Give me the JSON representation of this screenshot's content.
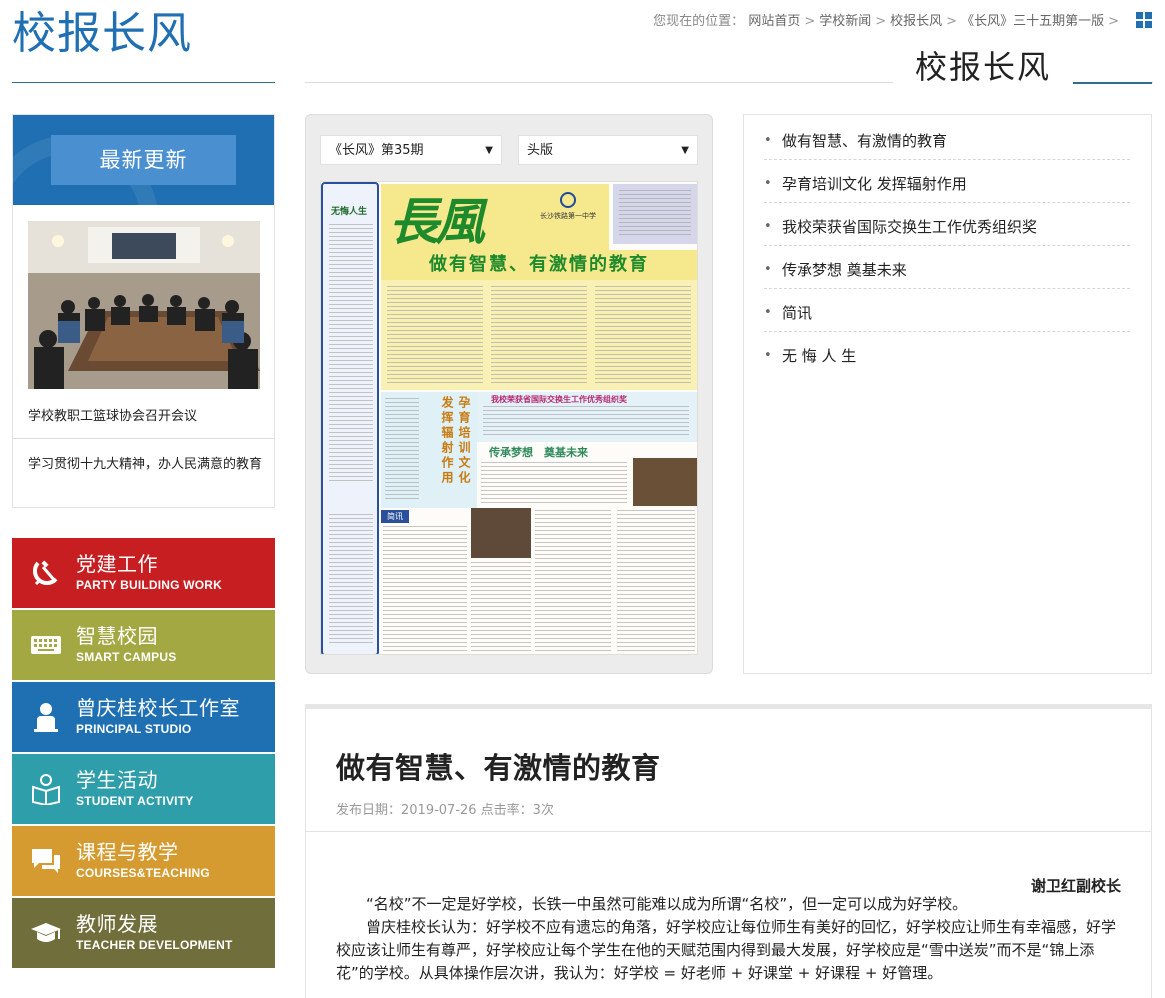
{
  "site": {
    "title": "校报长风",
    "section_title": "校报长风"
  },
  "breadcrumb": {
    "prefix": "您现在的位置：",
    "items": [
      "网站首页",
      "学校新闻",
      "校报长风",
      "《长风》三十五期第一版"
    ],
    "separator": ">"
  },
  "latest": {
    "heading": "最新更新",
    "items": [
      {
        "caption": "学校教职工篮球协会召开会议"
      },
      {
        "caption": "学习贯彻十九大精神，办人民满意的教育"
      }
    ]
  },
  "nav": [
    {
      "cn": "党建工作",
      "en": "PARTY BUILDING WORK",
      "color": "#c71e22",
      "icon": "hammer-sickle-icon"
    },
    {
      "cn": "智慧校园",
      "en": "SMART CAMPUS",
      "color": "#a3a843",
      "icon": "keyboard-icon"
    },
    {
      "cn": "曾庆桂校长工作室",
      "en": "PRINCIPAL STUDIO",
      "color": "#1e70b3",
      "icon": "person-icon"
    },
    {
      "cn": "学生活动",
      "en": "STUDENT ACTIVITY",
      "color": "#2f9eab",
      "icon": "reading-student-icon"
    },
    {
      "cn": "课程与教学",
      "en": "COURSES&TEACHING",
      "color": "#d59b30",
      "icon": "chat-bubbles-icon"
    },
    {
      "cn": "教师发展",
      "en": "TEACHER DEVELOPMENT",
      "color": "#706e3a",
      "icon": "graduation-cap-icon"
    }
  ],
  "viewer": {
    "issue_select": "《长风》第35期",
    "page_select": "头版",
    "paper": {
      "left_col_title": "无悔人生",
      "logo": "長風",
      "school": "长沙铁路第一中学",
      "headline": "做有智慧、有激情的教育",
      "vertical_title": "孕育培训文化 发挥辐射作用",
      "blue_title": "我校荣获省国际交换生工作优秀组织奖",
      "subtitle": "传承梦想　奠基未来",
      "brief": "简讯"
    }
  },
  "headlines": [
    "做有智慧、有激情的教育",
    "孕育培训文化 发挥辐射作用",
    "我校荣获省国际交换生工作优秀组织奖",
    "传承梦想 奠基未来",
    "简讯",
    "无 悔 人 生"
  ],
  "article": {
    "title": "做有智慧、有激情的教育",
    "meta": "发布日期：2019-07-26 点击率：3次",
    "author": "谢卫红副校长",
    "paragraphs": [
      "“名校”不一定是好学校，长铁一中虽然可能难以成为所谓“名校”，但一定可以成为好学校。",
      "曾庆桂校长认为：好学校不应有遗忘的角落，好学校应让每位师生有美好的回忆，好学校应让师生有幸福感，好学校应该让师生有尊严，好学校应让每个学生在他的天赋范围内得到最大发展，好学校应是“雪中送炭”而不是“锦上添花”的学校。从具体操作层次讲，我认为：好学校 = 好老师 + 好课堂 + 好课程 + 好管理。"
    ]
  },
  "colors": {
    "brand_blue": "#1f6fb2",
    "accent_teal": "#2f6f87"
  }
}
